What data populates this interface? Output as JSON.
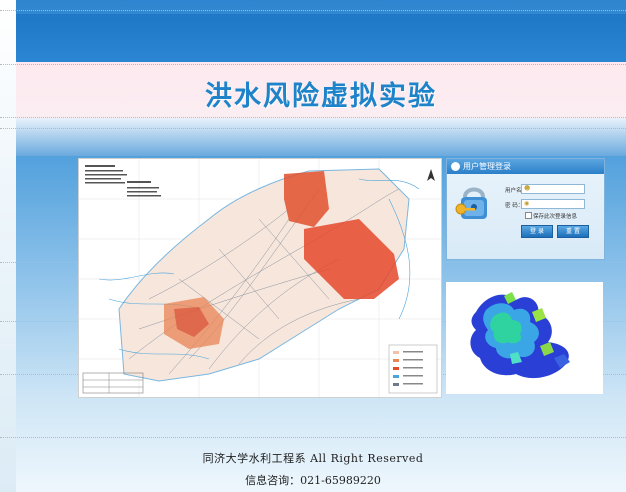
{
  "banner": {
    "title": "洪水风险虚拟实验"
  },
  "login": {
    "header": "用户管理登录",
    "username_label": "用户名：",
    "password_label": "密  码：",
    "remember_label": "保存此次登录信息",
    "login_button": "登 录",
    "reset_button": "重 置"
  },
  "icons": {
    "login_art": "padlock-key-icon",
    "header": "user-icon"
  },
  "footer": {
    "line1": "同济大学水利工程系  All Right Reserved",
    "line2": "信息咨询：021-65989220"
  },
  "colors": {
    "top_bar": "#2b86d3",
    "title": "#1e83c9",
    "login_button": "#1c6fb9"
  }
}
